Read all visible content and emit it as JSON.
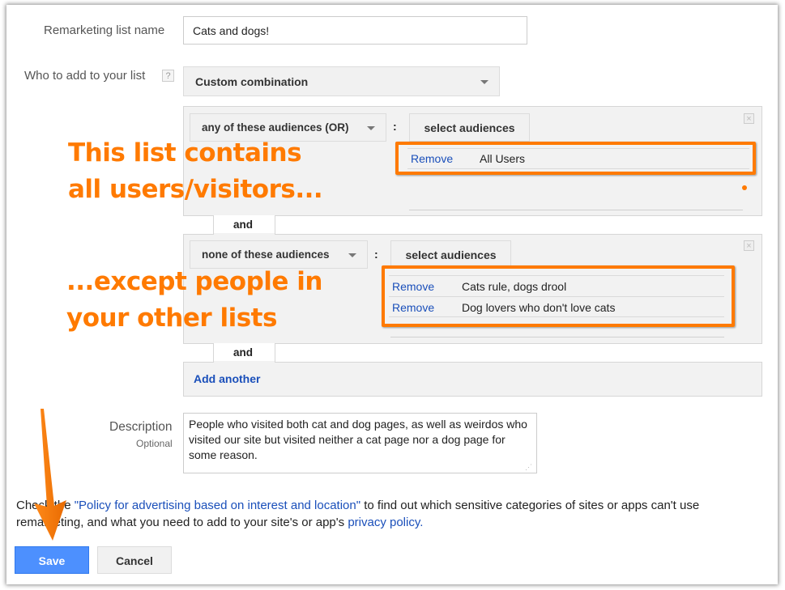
{
  "form": {
    "list_name_label": "Remarketing list name",
    "list_name_value": "Cats and dogs!",
    "who_label": "Who to add to your list",
    "help_icon": "?",
    "who_value": "Custom combination",
    "description_label": "Description",
    "description_sublabel": "Optional",
    "description_value": "People who visited both cat and dog pages, as well as weirdos who visited our site but visited neither a cat page nor a dog page for some reason."
  },
  "groups": [
    {
      "operator": "any of these audiences (OR)",
      "select_label": "select audiences",
      "separator": ":",
      "audiences": [
        {
          "action": "Remove",
          "name": "All Users"
        }
      ]
    },
    {
      "operator": "none of these audiences",
      "select_label": "select audiences",
      "separator": ":",
      "audiences": [
        {
          "action": "Remove",
          "name": "Cats rule, dogs drool"
        },
        {
          "action": "Remove",
          "name": "Dog lovers who don't love cats"
        }
      ]
    }
  ],
  "and_label": "and",
  "add_another": "Add another",
  "policy": {
    "prefix": "Check the ",
    "link1": "\"Policy for advertising based on interest and location\"",
    "middle": " to find out which sensitive categories of sites or apps can't use remarketing, and what you need to add to your site's or app's ",
    "link2": "privacy policy",
    "suffix": "."
  },
  "buttons": {
    "save": "Save",
    "cancel": "Cancel"
  },
  "annotations": {
    "top_line1": "This list contains",
    "top_line2": "all users/visitors...",
    "bottom_line1": "...except people in",
    "bottom_line2": "your other lists"
  },
  "colors": {
    "accent": "#ff7a00",
    "save_button": "#4d90fe",
    "link": "#1a4fba"
  }
}
